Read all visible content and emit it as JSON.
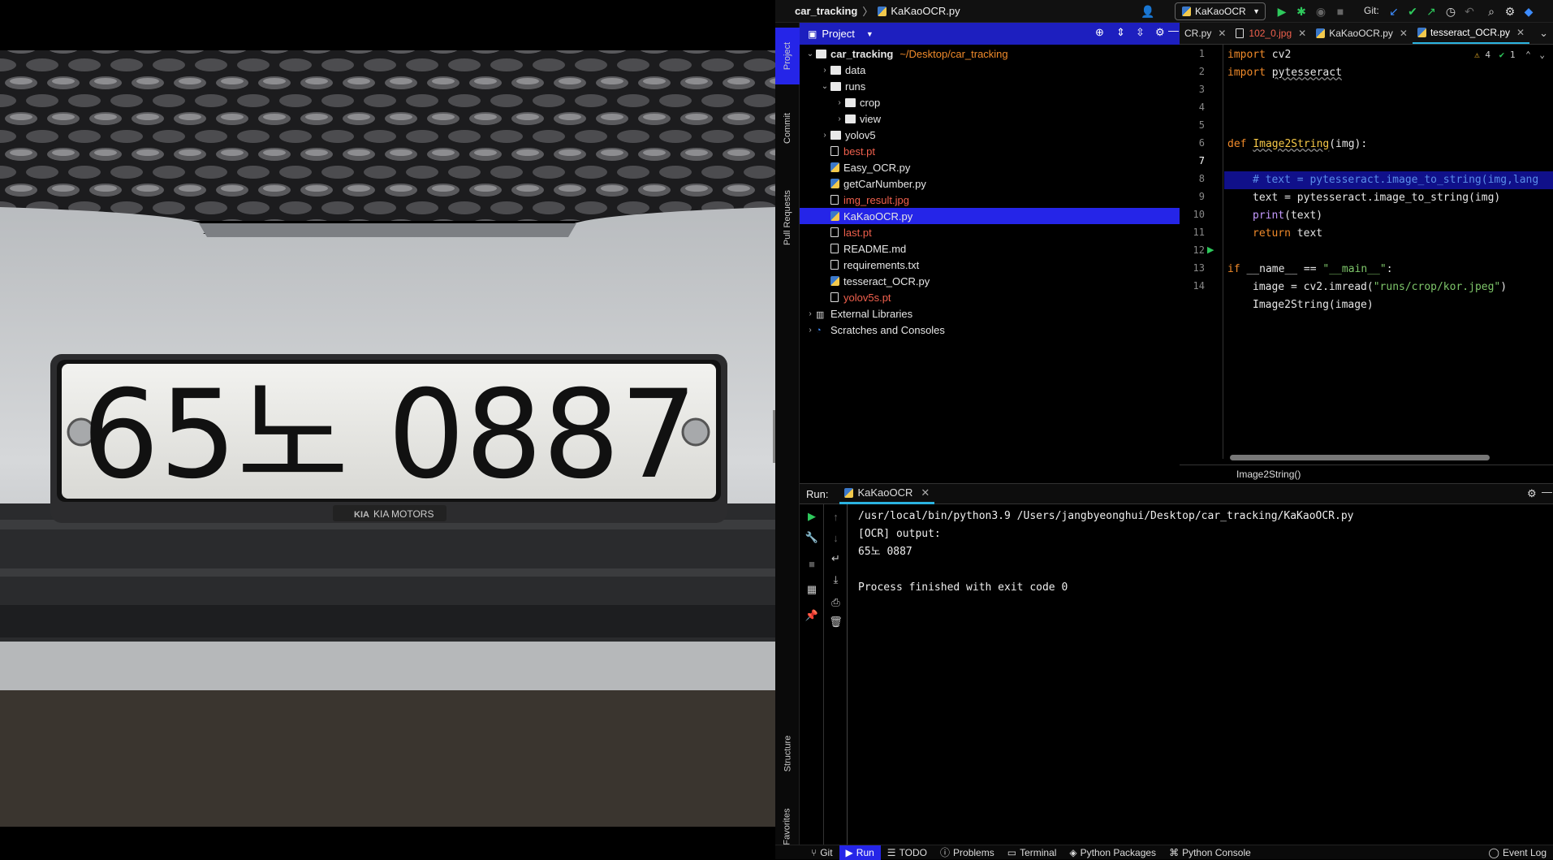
{
  "photo": {
    "plate_text": "65노 0887",
    "badge_text": "KIA MOTORS",
    "badge_logo": "KIA",
    "colors": {
      "plate": "#e9e9e6",
      "grille": "#2a2a2c",
      "bumper": "#c9cbcd"
    }
  },
  "navbar": {
    "project": "car_tracking",
    "file": "KaKaoOCR.py",
    "run_config": "KaKaoOCR",
    "git_label": "Git:"
  },
  "stripe": {
    "project": "Project",
    "commit": "Commit",
    "pull_requests": "Pull Requests",
    "structure": "Structure",
    "favorites": "Favorites"
  },
  "project_panel": {
    "title": "Project",
    "root_name": "car_tracking",
    "root_path": "~/Desktop/car_tracking",
    "items": [
      {
        "label": "data",
        "kind": "folder",
        "depth": 1,
        "state": "collapsed"
      },
      {
        "label": "runs",
        "kind": "folder",
        "depth": 1,
        "state": "expanded"
      },
      {
        "label": "crop",
        "kind": "folder",
        "depth": 2,
        "state": "collapsed"
      },
      {
        "label": "view",
        "kind": "folder",
        "depth": 2,
        "state": "collapsed"
      },
      {
        "label": "yolov5",
        "kind": "folder",
        "depth": 1,
        "state": "collapsed"
      },
      {
        "label": "best.pt",
        "kind": "file",
        "depth": 1,
        "ignored": true
      },
      {
        "label": "Easy_OCR.py",
        "kind": "py",
        "depth": 1
      },
      {
        "label": "getCarNumber.py",
        "kind": "py",
        "depth": 1
      },
      {
        "label": "img_result.jpg",
        "kind": "img",
        "depth": 1,
        "ignored": true
      },
      {
        "label": "KaKaoOCR.py",
        "kind": "py",
        "depth": 1,
        "selected": true
      },
      {
        "label": "last.pt",
        "kind": "file",
        "depth": 1,
        "ignored": true
      },
      {
        "label": "README.md",
        "kind": "md",
        "depth": 1
      },
      {
        "label": "requirements.txt",
        "kind": "file",
        "depth": 1
      },
      {
        "label": "tesseract_OCR.py",
        "kind": "py",
        "depth": 1
      },
      {
        "label": "yolov5s.pt",
        "kind": "file",
        "depth": 1,
        "ignored": true
      },
      {
        "label": "External Libraries",
        "kind": "lib",
        "depth": 0,
        "state": "collapsed"
      },
      {
        "label": "Scratches and Consoles",
        "kind": "scratch",
        "depth": 0,
        "state": "collapsed"
      }
    ]
  },
  "editor": {
    "tabs": [
      {
        "label": "CR.py"
      },
      {
        "label": "102_0.jpg",
        "ignored": true
      },
      {
        "label": "KaKaoOCR.py"
      },
      {
        "label": "tesseract_OCR.py",
        "active": true
      }
    ],
    "inspections": {
      "warnings": "4",
      "ok": "1"
    },
    "line_numbers": [
      "1",
      "2",
      "3",
      "4",
      "5",
      "6",
      "7",
      "8",
      "9",
      "10",
      "11",
      "12",
      "13",
      "14"
    ],
    "breadcrumb": "Image2String()"
  },
  "run": {
    "label": "Run:",
    "tab": "KaKaoOCR",
    "console": [
      "/usr/local/bin/python3.9 /Users/jangbyeonghui/Desktop/car_tracking/KaKaoOCR.py",
      "[OCR] output:",
      "65노 0887",
      "",
      "Process finished with exit code 0"
    ]
  },
  "status_bar": {
    "git": "Git",
    "run": "Run",
    "todo": "TODO",
    "problems": "Problems",
    "terminal": "Terminal",
    "python_packages": "Python Packages",
    "python_console": "Python Console",
    "event_log": "Event Log"
  }
}
